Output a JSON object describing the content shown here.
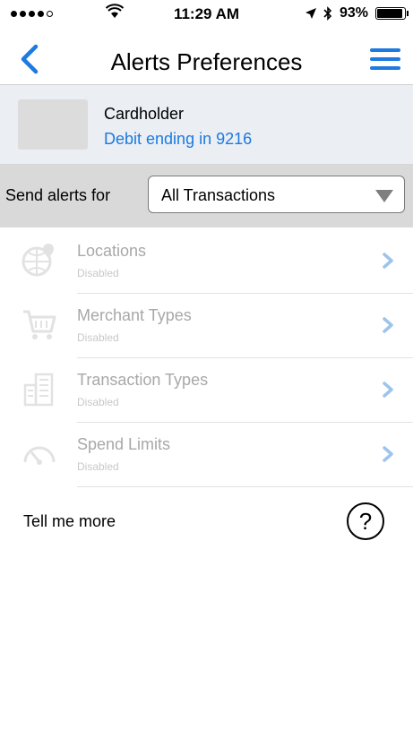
{
  "status_bar": {
    "time": "11:29 AM",
    "battery": "93%",
    "battery_level": 0.93
  },
  "nav": {
    "title": "Alerts Preferences",
    "back_icon": "chevron-left-icon",
    "menu_icon": "hamburger-menu-icon",
    "accent_color": "#1c7ae0"
  },
  "card": {
    "holder": "Cardholder",
    "account": "Debit ending in 9216"
  },
  "send_alerts": {
    "label": "Send alerts for",
    "selected": "All Transactions"
  },
  "rows": [
    {
      "title": "Locations",
      "status": "Disabled",
      "icon": "globe-pin-icon"
    },
    {
      "title": "Merchant Types",
      "status": "Disabled",
      "icon": "shopping-cart-icon"
    },
    {
      "title": "Transaction Types",
      "status": "Disabled",
      "icon": "buildings-icon"
    },
    {
      "title": "Spend Limits",
      "status": "Disabled",
      "icon": "gauge-icon"
    }
  ],
  "help": {
    "label": "Tell me more",
    "icon": "question-circle-icon"
  }
}
